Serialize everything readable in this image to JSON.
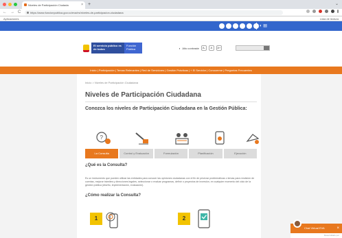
{
  "browser": {
    "tab_title": "Niveles de Participación Ciudada",
    "tab_close": "×",
    "new_tab": "+",
    "url": "https://www.funcionpublica.gov.co/eva/es/niveles-de-participacion-ciudadana",
    "nav_back": "←",
    "nav_forward": "→",
    "nav_reload": "C",
    "bookmark_left": "Aplicaciones",
    "bookmark_right": "Lista de lectura",
    "window_control": "⌄"
  },
  "gov_bar": {
    "color": "#3366cc",
    "icon": "accessibility-icons"
  },
  "header": {
    "logo_text": "El servicio público es de todos",
    "logo_secondary": "Función Pública",
    "contrast_label": "Alto contraste",
    "font_minus": "A-",
    "font_reset": "A",
    "font_plus": "A+"
  },
  "main_nav": {
    "items": "Inicio | Participación | Temas Relevantes | Red de Servidores | Gestión Prácticas | + El Servidor | Conocerme | Preguntas Frecuentes"
  },
  "page": {
    "breadcrumb": "Inicio > Niveles de Participación Ciudadana",
    "title": "Niveles de Participación Ciudadana",
    "subtitle": "Conozca los niveles de Participación Ciudadana en la Gestión Pública:",
    "tabs": [
      {
        "label": "La Consulta",
        "active": true
      },
      {
        "label": "Control y Evaluación",
        "active": false
      },
      {
        "label": "Formulación",
        "active": false
      },
      {
        "label": "Planificación",
        "active": false
      },
      {
        "label": "Ejecución",
        "active": false
      }
    ],
    "what_heading": "¿Qué es la Consulta?",
    "what_text": "Es un instrumento que pueden utilizar las entidades para conocer las opiniones ciudadanas con el fin de priorizar problemáticas o temas para rendición de cuentas, mejorar trámites y direcciones legales, seleccionar o evaluar programas, definir o proyectos de inversión, en cualquier momento del ciclo de la gestión pública (diseño, implementación, evaluación).",
    "how_heading": "¿Cómo realizar la Consulta?",
    "steps": [
      "1",
      "2"
    ]
  },
  "chat": {
    "label": "Chat Virtual EVA",
    "close": "×",
    "footer": "Desarrollado por"
  },
  "colors": {
    "accent": "#e8781e",
    "gov_blue": "#3366cc",
    "step_yellow": "#f2c300"
  }
}
